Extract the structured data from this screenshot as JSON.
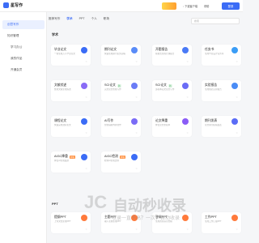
{
  "app": {
    "name": "星写作"
  },
  "topbar": {
    "download": "下载客户端",
    "user": "帮助",
    "login": "登录"
  },
  "sidebar": {
    "items": [
      {
        "label": "创意写作"
      },
      {
        "label": "知识管理"
      },
      {
        "label": "学习办公"
      },
      {
        "label": "我的作品"
      },
      {
        "label": "开通会员"
      }
    ]
  },
  "tabs": [
    {
      "label": "推荐写作"
    },
    {
      "label": "学术"
    },
    {
      "label": "PPT"
    },
    {
      "label": "个人"
    },
    {
      "label": "职场"
    }
  ],
  "search": {
    "placeholder": "搜索"
  },
  "sections": {
    "academic": "学术",
    "ppt": "PPT"
  },
  "cards": [
    {
      "title": "毕业论文",
      "badge": "",
      "desc": "一键生成万字毕业论文",
      "icon_color": "#3b6cf6"
    },
    {
      "title": "期刊论文",
      "badge": "",
      "desc": "快速生成期刊论文初稿",
      "icon_color": "#5a8cf8"
    },
    {
      "title": "开题报告",
      "badge": "",
      "desc": "按格式生成开题报告",
      "icon_color": "#4a7af6"
    },
    {
      "title": "任务书",
      "badge": "",
      "desc": "生成毕业设计任务书",
      "icon_color": "#3b9df6"
    },
    {
      "title": "文献综述",
      "badge": "",
      "desc": "整理文献生成综述",
      "icon_color": "#8a6cf6"
    },
    {
      "title": "SCI论文",
      "badge": "新",
      "desc": "英文论文智能写作",
      "icon_color": "#6a7cf6"
    },
    {
      "title": "SCI论文",
      "badge": "新",
      "desc": "多版本英文论文写作",
      "icon_color": "#6a6cf6"
    },
    {
      "title": "实验报告",
      "badge": "",
      "desc": "生成规范实验报告",
      "icon_color": "#4a8cf6"
    },
    {
      "title": "课程论文",
      "badge": "",
      "desc": "快速完成课程论文",
      "icon_color": "#3b6cf6"
    },
    {
      "title": "AI写作",
      "badge": "",
      "desc": "智能辅助内容创作",
      "icon_color": "#7a6cf6"
    },
    {
      "title": "论文降重",
      "badge": "",
      "desc": "降低论文重复率",
      "icon_color": "#8a5cf6"
    },
    {
      "title": "期刊发表",
      "badge": "",
      "desc": "论文期刊投稿发表",
      "icon_color": "#5a6cf6"
    },
    {
      "title": "AIGC降重",
      "badge": "新版",
      "desc": "降低AI生成痕迹",
      "icon_color": "#3b6cf6"
    },
    {
      "title": "AIGC检测",
      "badge": "新版",
      "desc": "检测AI生成比例",
      "icon_color": "#3b6cf6"
    },
    {
      "title": "提纲PPT",
      "badge": "",
      "desc": "上传文档生成PPT",
      "icon_color": "#ff7a3b"
    },
    {
      "title": "主题PPT",
      "badge": "",
      "desc": "输入主题生成PPT",
      "icon_color": "#ff7a3b"
    },
    {
      "title": "答辩PPT",
      "badge": "",
      "desc": "生成答辩演示文稿",
      "icon_color": "#ff7a3b"
    },
    {
      "title": "工作PPT",
      "badge": "",
      "desc": "生成工作汇报PPT",
      "icon_color": "#ff7a3b"
    }
  ],
  "watermark": {
    "brand": "自动秒收录",
    "sub": "收录一直不高？一次，自动收录"
  }
}
